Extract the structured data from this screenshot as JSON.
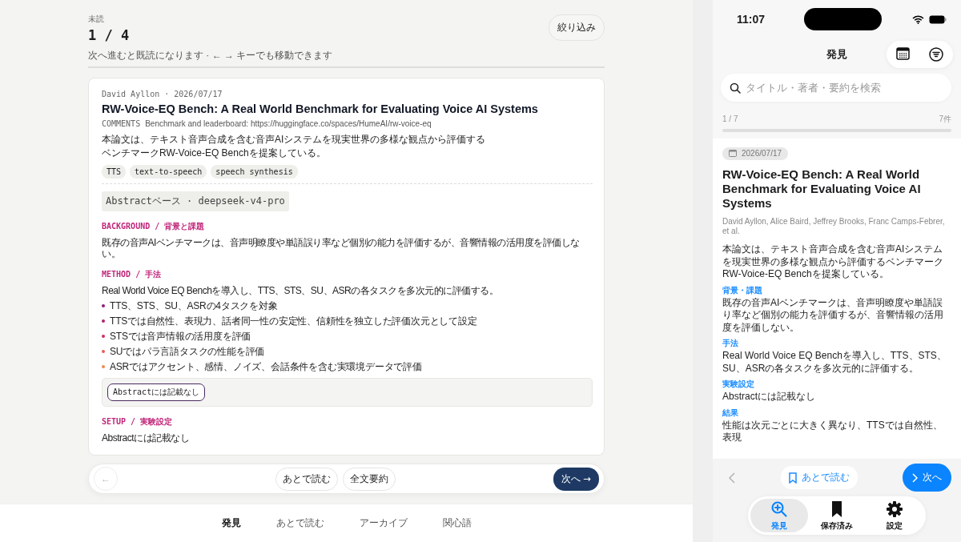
{
  "reader": {
    "unread_label": "未読",
    "counter": "1 / 4",
    "filter_button": "絞り込み",
    "hint": "次へ進むと既読になります · ← → キーでも移動できます",
    "paper": {
      "meta": "David Ayllon · 2026/07/17",
      "title": "RW-Voice-EQ Bench: A Real World Benchmark for Evaluating Voice AI Systems",
      "comments_label": "COMMENTS",
      "comments": "Benchmark and leaderboard: https://huggingface.co/spaces/HumeAI/rw-voice-eq",
      "summary": "本論文は、テキスト音声合成を含む音声AIシステムを現実世界の多様な観点から評価するベンチマークRW-Voice-EQ Benchを提案している。",
      "tags": [
        "TTS",
        "text-to-speech",
        "speech synthesis"
      ],
      "source_badge": "Abstractベース · deepseek-v4-pro",
      "sections": [
        {
          "kind": "text",
          "heading": "BACKGROUND / 背景と課題",
          "text": "既存の音声AIベンチマークは、音声明瞭度や単語誤り率など個別の能力を評価するが、音響情報の活用度を評価しない。"
        },
        {
          "kind": "list",
          "heading": "METHOD / 手法",
          "text": "Real World Voice EQ Benchを導入し、TTS、STS、SU、ASRの各タスクを多次元的に評価する。",
          "bullets": [
            {
              "text": "TTS、STS、SU、ASRの4タスクを対象",
              "color": "#8e1f7a"
            },
            {
              "text": "TTSでは自然性、表現力、話者同一性の安定性、信頼性を独立した評価次元として設定",
              "color": "#b0246e"
            },
            {
              "text": "STSでは音声情報の活用度を評価",
              "color": "#cf2f63"
            },
            {
              "text": "SUではパラ言語タスクの性能を評価",
              "color": "#e85d5a"
            },
            {
              "text": "ASRではアクセント、感情、ノイズ、会話条件を含む実環境データで評価",
              "color": "#f08a4b"
            }
          ],
          "note": "Abstractには記載なし"
        },
        {
          "kind": "text",
          "heading": "SETUP / 実験設定",
          "text": "Abstractには記載なし"
        }
      ]
    },
    "action_bar": {
      "back": "←",
      "later": "あとで読む",
      "full_summary": "全文要約",
      "next": "次へ →"
    },
    "tabs": [
      {
        "label": "発見",
        "selected": true
      },
      {
        "label": "あとで読む",
        "selected": false
      },
      {
        "label": "アーカイブ",
        "selected": false
      },
      {
        "label": "関心語",
        "selected": false
      }
    ]
  },
  "phone": {
    "time": "11:07",
    "title": "発見",
    "search": {
      "placeholder": "タイトル・著者・要約を検索"
    },
    "position": "1 / 7",
    "count": "7件",
    "paper": {
      "date": "2026/07/17",
      "title": "RW-Voice-EQ Bench: A Real World Benchmark for Evaluating Voice AI Systems",
      "authors": "David Ayllon, Alice Baird, Jeffrey Brooks, Franc Camps-Febrer, et al.",
      "summary": "本論文は、テキスト音声合成を含む音声AIシステムを現実世界の多様な観点から評価するベンチマークRW-Voice-EQ Benchを提案している。",
      "sections": [
        {
          "heading": "背景・課題",
          "text": "既存の音声AIベンチマークは、音声明瞭度や単語誤り率など個別の能力を評価するが、音響情報の活用度を評価しない。"
        },
        {
          "heading": "手法",
          "text": "Real World Voice EQ Benchを導入し、TTS、STS、SU、ASRの各タスクを多次元的に評価する。"
        },
        {
          "heading": "実験設定",
          "text": "Abstractには記載なし"
        },
        {
          "heading": "結果",
          "text": "性能は次元ごとに大きく異なり、TTSでは自然性、表現"
        }
      ]
    },
    "later_button": "あとで読む",
    "next_button": "次へ",
    "tabs": [
      {
        "label": "発見",
        "selected": true
      },
      {
        "label": "保存済み",
        "selected": false
      },
      {
        "label": "設定",
        "selected": false
      }
    ]
  }
}
